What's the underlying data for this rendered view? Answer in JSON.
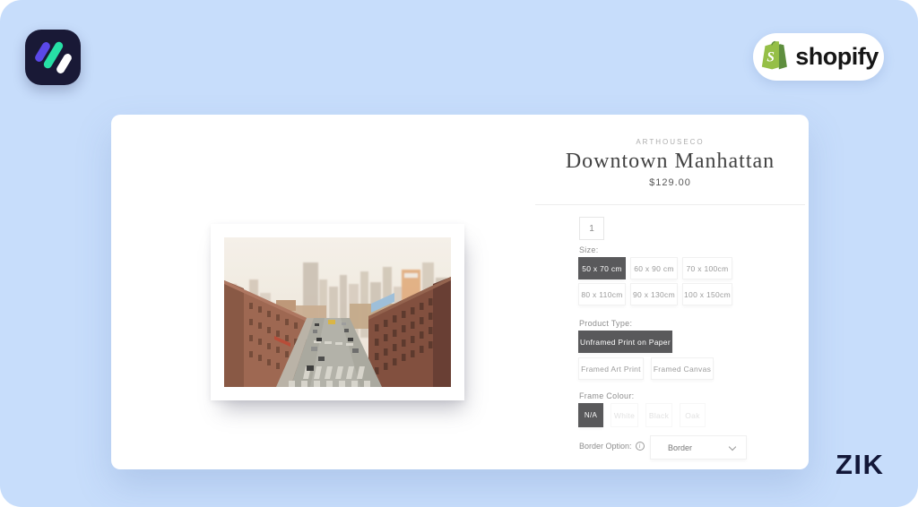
{
  "header": {
    "shopify_label": "shopify"
  },
  "watermark": "ZIK",
  "product": {
    "vendor": "ARTHOUSECO",
    "title": "Downtown Manhattan",
    "price": "$129.00",
    "quantity": "1"
  },
  "options": {
    "size": {
      "label": "Size:",
      "values": [
        "50 x 70 cm",
        "60 x 90 cm",
        "70 x 100cm",
        "80 x 110cm",
        "90 x 130cm",
        "100 x 150cm"
      ],
      "selected": "50 x 70 cm"
    },
    "product_type": {
      "label": "Product Type:",
      "values": [
        "Unframed Print on Paper",
        "Framed Art Print",
        "Framed Canvas"
      ],
      "selected": "Unframed Print on Paper"
    },
    "frame_colour": {
      "label": "Frame Colour:",
      "values": [
        "N/A",
        "White",
        "Black",
        "Oak"
      ],
      "selected": "N/A"
    },
    "border": {
      "label": "Border Option:",
      "selected": "Border"
    }
  },
  "icons": {
    "zik_logo": "three-diagonal-stripes",
    "shopify_bag": "green-shopping-bag",
    "info": "circled-i",
    "chevron": "chevron-down"
  },
  "colors": {
    "background_blue": "#c7ddfb",
    "selected_button": "#59595b",
    "logo_navy": "#191936",
    "shopify_green": "#95bf47",
    "shopify_green_dark": "#5e8e3e",
    "watermark_navy": "#121738"
  }
}
